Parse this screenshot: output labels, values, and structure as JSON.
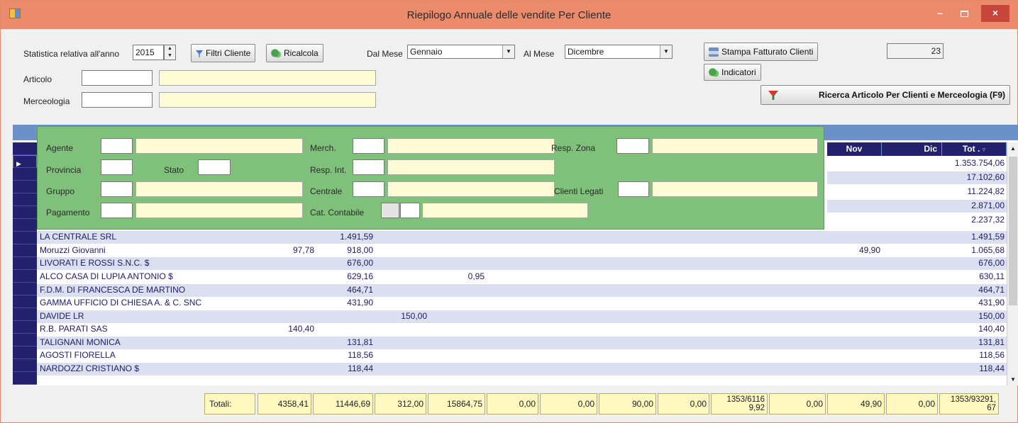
{
  "window": {
    "title": "Riepilogo Annuale delle vendite Per Cliente",
    "min": "–",
    "close": "×"
  },
  "toolbar": {
    "year_label": "Statistica relativa all'anno",
    "year_value": "2015",
    "filtri_label": "Filtri Cliente",
    "ricalcola_label": "Ricalcola",
    "dal_mese_label": "Dal Mese",
    "dal_mese_value": "Gennaio",
    "al_mese_label": "Al Mese",
    "al_mese_value": "Dicembre",
    "stampa_label": "Stampa Fatturato Clienti",
    "indicatori_label": "Indicatori",
    "count_value": "23",
    "ricerca_label": "Ricerca Articolo Per Clienti e Merceologia (F9)",
    "articolo_label": "Articolo",
    "merceologia_label": "Merceologia"
  },
  "filters": {
    "agente": "Agente",
    "provincia": "Provincia",
    "stato": "Stato",
    "gruppo": "Gruppo",
    "pagamento": "Pagamento",
    "merch": "Merch.",
    "resp_int": "Resp. Int.",
    "centrale": "Centrale",
    "cat_contabile": "Cat. Contabile",
    "resp_zona": "Resp. Zona",
    "clienti_legati": "Clienti Legati"
  },
  "columns": {
    "nov": "Nov",
    "dic": "Dic",
    "tot": "Tot ."
  },
  "top_totals": [
    "1.353.754,06",
    "17.102,60",
    "11.224,82",
    "2.871,00",
    "2.237,32"
  ],
  "rows": [
    {
      "name": "LA CENTRALE SRL",
      "c1": "",
      "c2": "1.491,59",
      "c3": "",
      "c4": "",
      "nov": "",
      "tot": "1.491,59"
    },
    {
      "name": "Moruzzi Giovanni",
      "c1": "97,78",
      "c2": "918,00",
      "c3": "",
      "c4": "",
      "nov": "49,90",
      "tot": "1.065,68"
    },
    {
      "name": "LIVORATI E ROSSI S.N.C. $",
      "c1": "",
      "c2": "676,00",
      "c3": "",
      "c4": "",
      "nov": "",
      "tot": "676,00"
    },
    {
      "name": "ALCO CASA DI LUPIA ANTONIO $",
      "c1": "",
      "c2": "629,16",
      "c3": "",
      "c4": "0,95",
      "nov": "",
      "tot": "630,11"
    },
    {
      "name": "F.D.M. DI FRANCESCA DE MARTINO",
      "c1": "",
      "c2": "464,71",
      "c3": "",
      "c4": "",
      "nov": "",
      "tot": "464,71"
    },
    {
      "name": "GAMMA UFFICIO DI CHIESA A. & C. SNC",
      "c1": "",
      "c2": "431,90",
      "c3": "",
      "c4": "",
      "nov": "",
      "tot": "431,90"
    },
    {
      "name": "DAVIDE LR",
      "c1": "",
      "c2": "",
      "c3": "150,00",
      "c4": "",
      "nov": "",
      "tot": "150,00"
    },
    {
      "name": "R.B. PARATI SAS",
      "c1": "140,40",
      "c2": "",
      "c3": "",
      "c4": "",
      "nov": "",
      "tot": "140,40"
    },
    {
      "name": "TALIGNANI MONICA",
      "c1": "",
      "c2": "131,81",
      "c3": "",
      "c4": "",
      "nov": "",
      "tot": "131,81"
    },
    {
      "name": "AGOSTI FIORELLA",
      "c1": "",
      "c2": "118,56",
      "c3": "",
      "c4": "",
      "nov": "",
      "tot": "118,56"
    },
    {
      "name": "NARDOZZI CRISTIANO $",
      "c1": "",
      "c2": "118,44",
      "c3": "",
      "c4": "",
      "nov": "",
      "tot": "118,44"
    }
  ],
  "totals": {
    "label": "Totali:",
    "v1": "4358,41",
    "v2": "11446,69",
    "v3": "312,00",
    "v4": "15864,75",
    "v5": "0,00",
    "v6": "0,00",
    "v7": "90,00",
    "v8": "0,00",
    "v9a": "1353/6116",
    "v9b": "9,92",
    "v10": "0,00",
    "v11": "49,90",
    "v12": "0,00",
    "v13a": "1353/93291,",
    "v13b": "67"
  }
}
